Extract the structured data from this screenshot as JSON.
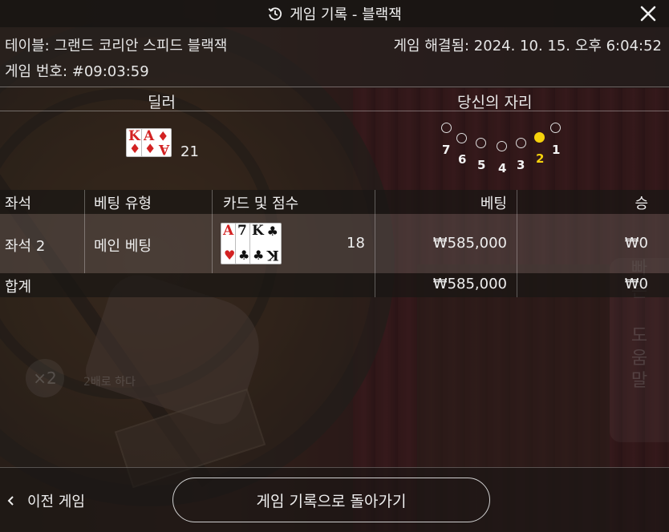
{
  "header": {
    "title": "게임 기록 - 블랙잭",
    "history_icon": "history-icon",
    "close_icon": "close-icon"
  },
  "info": {
    "table_label": "테이블: 그랜드 코리안 스피드 블랙잭",
    "resolved_label": "게임 해결됨: 2024. 10. 15. 오후 6:04:52",
    "game_number_label": "게임 번호: #09:03:59"
  },
  "dealer": {
    "heading": "딜러",
    "cards": [
      {
        "rank": "K",
        "suit": "♦",
        "color": "red"
      },
      {
        "rank": "A",
        "suit": "♦",
        "color": "red"
      }
    ],
    "score": "21"
  },
  "your_seat": {
    "heading": "당신의 자리",
    "seats": [
      "7",
      "6",
      "5",
      "4",
      "3",
      "2",
      "1"
    ],
    "active_seat": "2",
    "active_color": "#f5d20c"
  },
  "table": {
    "columns": [
      "좌석",
      "베팅 유형",
      "카드 및 점수",
      "베팅",
      "승"
    ],
    "rows": [
      {
        "seat": "좌석 2",
        "bet_type": "메인 베팅",
        "cards": [
          {
            "rank": "A",
            "suit": "♥",
            "color": "red"
          },
          {
            "rank": "7",
            "suit": "♣",
            "color": "black"
          },
          {
            "rank": "K",
            "suit": "♣",
            "color": "black"
          }
        ],
        "score": "18",
        "bet": "₩585,000",
        "win": "₩0"
      }
    ],
    "total": {
      "label": "합계",
      "bet": "₩585,000",
      "win": "₩0"
    }
  },
  "background": {
    "side_button_text": [
      "빠",
      "른",
      "",
      "도",
      "움",
      "말"
    ],
    "multiplier_text": "×2",
    "multiplier_label": "2배로 하다"
  },
  "footer": {
    "prev_label": "이전 게임",
    "back_label": "게임 기록으로 돌아가기"
  }
}
